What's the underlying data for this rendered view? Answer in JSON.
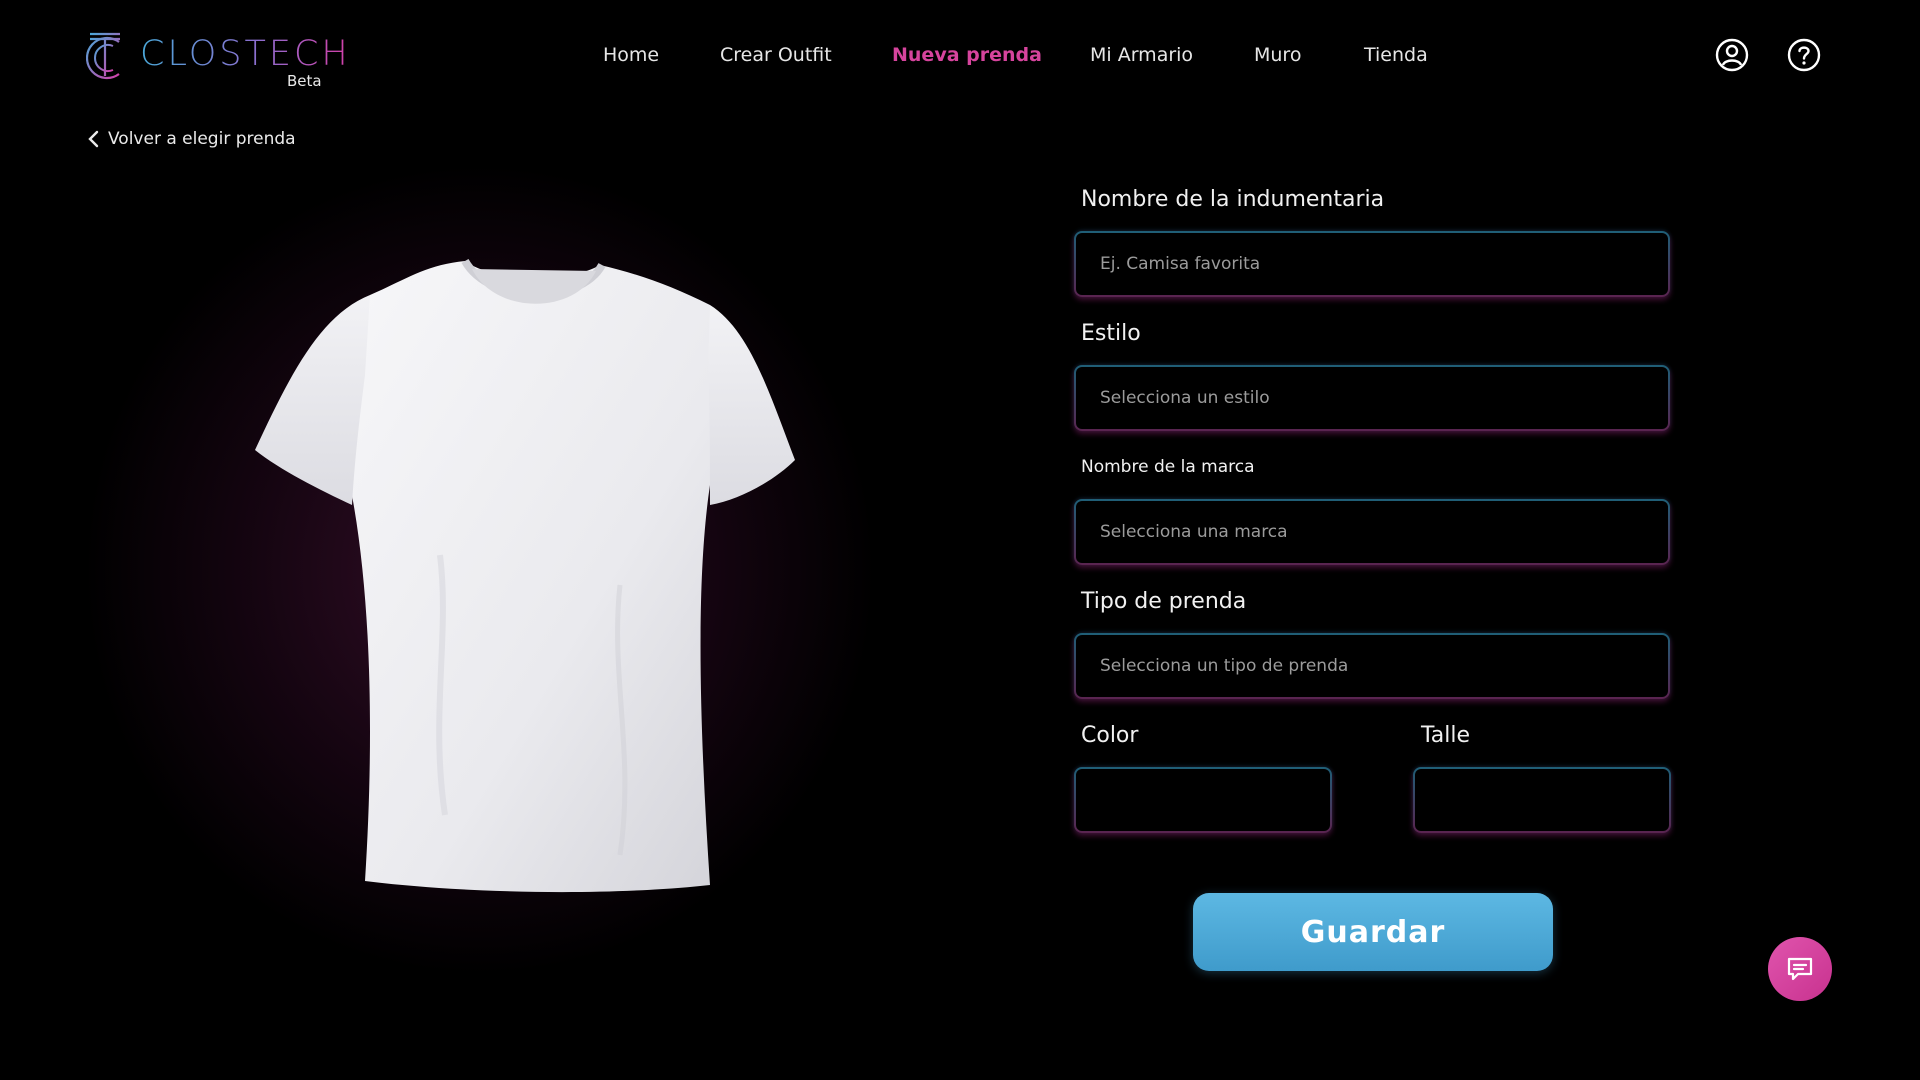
{
  "brand": {
    "name": "CLOSTECH",
    "tag": "Beta"
  },
  "nav": {
    "items": [
      {
        "label": "Home"
      },
      {
        "label": "Crear Outfit"
      },
      {
        "label": "Nueva prenda"
      },
      {
        "label": "Mi Armario"
      },
      {
        "label": "Muro"
      },
      {
        "label": "Tienda"
      }
    ],
    "active_index": 2
  },
  "header_icons": [
    "user-account-icon",
    "help-icon"
  ],
  "back_link": {
    "label": "Volver a elegir prenda",
    "icon": "chevron-left-icon"
  },
  "preview": {
    "image": "white-tshirt"
  },
  "form": {
    "name": {
      "label": "Nombre de la indumentaria",
      "placeholder": "Ej. Camisa favorita",
      "value": ""
    },
    "style": {
      "label": "Estilo",
      "placeholder": "Selecciona un estilo",
      "value": ""
    },
    "brand": {
      "label": "Nombre de la marca",
      "placeholder": "Selecciona una marca",
      "value": ""
    },
    "type": {
      "label": "Tipo de prenda",
      "placeholder": "Selecciona un tipo de prenda",
      "value": ""
    },
    "color": {
      "label": "Color",
      "value": ""
    },
    "size": {
      "label": "Talle",
      "value": ""
    },
    "save_label": "Guardar"
  },
  "chat_button": {
    "icon": "chat-icon"
  },
  "colors": {
    "accent_pink": "#d6449d",
    "accent_blue": "#4aa8d8",
    "button_blue": "#4fa9d7",
    "background": "#000000"
  }
}
